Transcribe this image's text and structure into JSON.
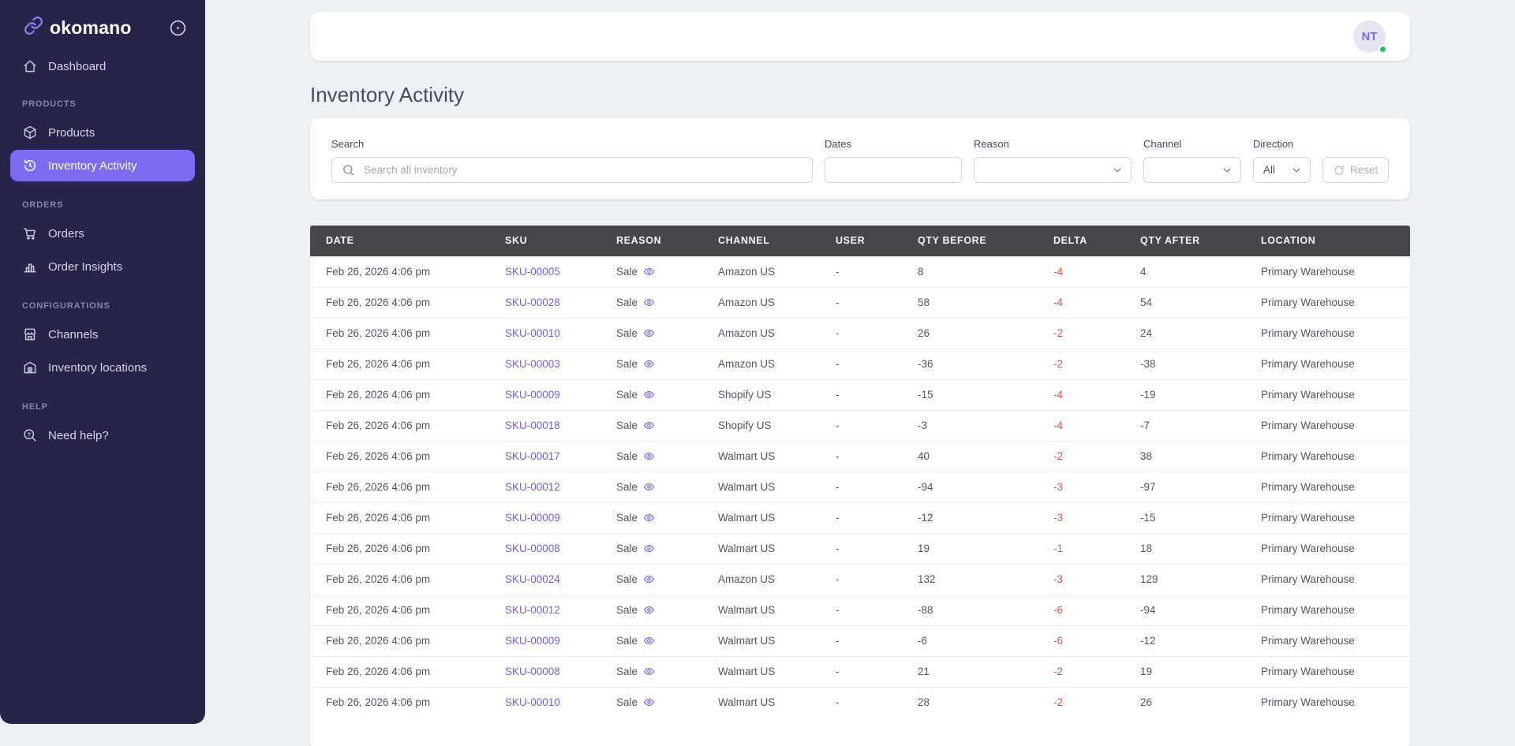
{
  "brand": {
    "name": "okomano"
  },
  "sidebar": {
    "sections": [
      {
        "label": "",
        "items": [
          {
            "label": "Dashboard"
          }
        ]
      },
      {
        "label": "PRODUCTS",
        "items": [
          {
            "label": "Products"
          },
          {
            "label": "Inventory Activity"
          }
        ]
      },
      {
        "label": "ORDERS",
        "items": [
          {
            "label": "Orders"
          },
          {
            "label": "Order Insights"
          }
        ]
      },
      {
        "label": "CONFIGURATIONS",
        "items": [
          {
            "label": "Channels"
          },
          {
            "label": "Inventory locations"
          }
        ]
      },
      {
        "label": "HELP",
        "items": [
          {
            "label": "Need help?"
          }
        ]
      }
    ]
  },
  "topbar": {
    "avatar_initials": "NT"
  },
  "page": {
    "title": "Inventory Activity"
  },
  "filters": {
    "search_label": "Search",
    "search_placeholder": "Search all inventory",
    "search_value": "",
    "dates_label": "Dates",
    "dates_value": "",
    "reason_label": "Reason",
    "reason_value": "",
    "channel_label": "Channel",
    "channel_value": "",
    "direction_label": "Direction",
    "direction_value": "All",
    "reset_label": "Reset"
  },
  "table": {
    "columns": [
      "DATE",
      "SKU",
      "REASON",
      "CHANNEL",
      "USER",
      "QTY BEFORE",
      "DELTA",
      "QTY AFTER",
      "LOCATION"
    ],
    "rows": [
      {
        "date": "Feb 26, 2026 4:06 pm",
        "sku": "SKU-00005",
        "reason": "Sale",
        "channel": "Amazon US",
        "user": "-",
        "qty_before": "8",
        "delta": "-4",
        "qty_after": "4",
        "location": "Primary Warehouse"
      },
      {
        "date": "Feb 26, 2026 4:06 pm",
        "sku": "SKU-00028",
        "reason": "Sale",
        "channel": "Amazon US",
        "user": "-",
        "qty_before": "58",
        "delta": "-4",
        "qty_after": "54",
        "location": "Primary Warehouse"
      },
      {
        "date": "Feb 26, 2026 4:06 pm",
        "sku": "SKU-00010",
        "reason": "Sale",
        "channel": "Amazon US",
        "user": "-",
        "qty_before": "26",
        "delta": "-2",
        "qty_after": "24",
        "location": "Primary Warehouse"
      },
      {
        "date": "Feb 26, 2026 4:06 pm",
        "sku": "SKU-00003",
        "reason": "Sale",
        "channel": "Amazon US",
        "user": "-",
        "qty_before": "-36",
        "delta": "-2",
        "qty_after": "-38",
        "location": "Primary Warehouse"
      },
      {
        "date": "Feb 26, 2026 4:06 pm",
        "sku": "SKU-00009",
        "reason": "Sale",
        "channel": "Shopify US",
        "user": "-",
        "qty_before": "-15",
        "delta": "-4",
        "qty_after": "-19",
        "location": "Primary Warehouse"
      },
      {
        "date": "Feb 26, 2026 4:06 pm",
        "sku": "SKU-00018",
        "reason": "Sale",
        "channel": "Shopify US",
        "user": "-",
        "qty_before": "-3",
        "delta": "-4",
        "qty_after": "-7",
        "location": "Primary Warehouse"
      },
      {
        "date": "Feb 26, 2026 4:06 pm",
        "sku": "SKU-00017",
        "reason": "Sale",
        "channel": "Walmart US",
        "user": "-",
        "qty_before": "40",
        "delta": "-2",
        "qty_after": "38",
        "location": "Primary Warehouse"
      },
      {
        "date": "Feb 26, 2026 4:06 pm",
        "sku": "SKU-00012",
        "reason": "Sale",
        "channel": "Walmart US",
        "user": "-",
        "qty_before": "-94",
        "delta": "-3",
        "qty_after": "-97",
        "location": "Primary Warehouse"
      },
      {
        "date": "Feb 26, 2026 4:06 pm",
        "sku": "SKU-00009",
        "reason": "Sale",
        "channel": "Walmart US",
        "user": "-",
        "qty_before": "-12",
        "delta": "-3",
        "qty_after": "-15",
        "location": "Primary Warehouse"
      },
      {
        "date": "Feb 26, 2026 4:06 pm",
        "sku": "SKU-00008",
        "reason": "Sale",
        "channel": "Walmart US",
        "user": "-",
        "qty_before": "19",
        "delta": "-1",
        "qty_after": "18",
        "location": "Primary Warehouse"
      },
      {
        "date": "Feb 26, 2026 4:06 pm",
        "sku": "SKU-00024",
        "reason": "Sale",
        "channel": "Amazon US",
        "user": "-",
        "qty_before": "132",
        "delta": "-3",
        "qty_after": "129",
        "location": "Primary Warehouse"
      },
      {
        "date": "Feb 26, 2026 4:06 pm",
        "sku": "SKU-00012",
        "reason": "Sale",
        "channel": "Walmart US",
        "user": "-",
        "qty_before": "-88",
        "delta": "-6",
        "qty_after": "-94",
        "location": "Primary Warehouse"
      },
      {
        "date": "Feb 26, 2026 4:06 pm",
        "sku": "SKU-00009",
        "reason": "Sale",
        "channel": "Walmart US",
        "user": "-",
        "qty_before": "-6",
        "delta": "-6",
        "qty_after": "-12",
        "location": "Primary Warehouse"
      },
      {
        "date": "Feb 26, 2026 4:06 pm",
        "sku": "SKU-00008",
        "reason": "Sale",
        "channel": "Walmart US",
        "user": "-",
        "qty_before": "21",
        "delta": "-2",
        "qty_after": "19",
        "location": "Primary Warehouse"
      },
      {
        "date": "Feb 26, 2026 4:06 pm",
        "sku": "SKU-00010",
        "reason": "Sale",
        "channel": "Walmart US",
        "user": "-",
        "qty_before": "28",
        "delta": "-2",
        "qty_after": "26",
        "location": "Primary Warehouse"
      }
    ]
  },
  "colors": {
    "sidebar_bg": "#282349",
    "accent": "#7c6cf2",
    "link": "#6d61e8",
    "delta_negative": "#e2544c",
    "status_online": "#22c55e",
    "table_header_bg": "#47474b"
  }
}
